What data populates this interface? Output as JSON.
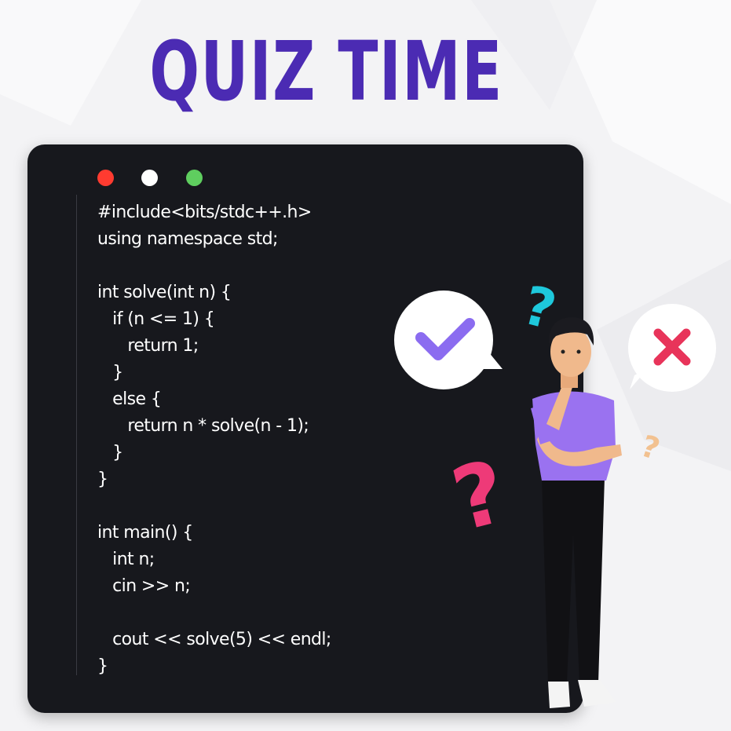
{
  "title": "QUIZ TIME",
  "window_controls": [
    "red",
    "white",
    "green"
  ],
  "code_lines": [
    "#include<bits/stdc++.h>",
    "using namespace std;",
    "",
    "int solve(int n) {",
    "   if (n <= 1) {",
    "      return 1;",
    "   }",
    "   else {",
    "      return n * solve(n - 1);",
    "   }",
    "}",
    "",
    "int main() {",
    "   int n;",
    "   cin >> n;",
    "",
    "   cout << solve(5) << endl;",
    "}"
  ],
  "icons": [
    "check-bubble-icon",
    "cross-bubble-icon",
    "question-mark-icon"
  ],
  "colors": {
    "title": "#4b2bb3",
    "editor_bg": "#17181d",
    "code_text": "#ffffff",
    "check": "#8b6cf0",
    "cross": "#e8345a",
    "question_cyan": "#1ec8dc",
    "question_pink": "#ee3a78",
    "shirt": "#9a72f0"
  }
}
